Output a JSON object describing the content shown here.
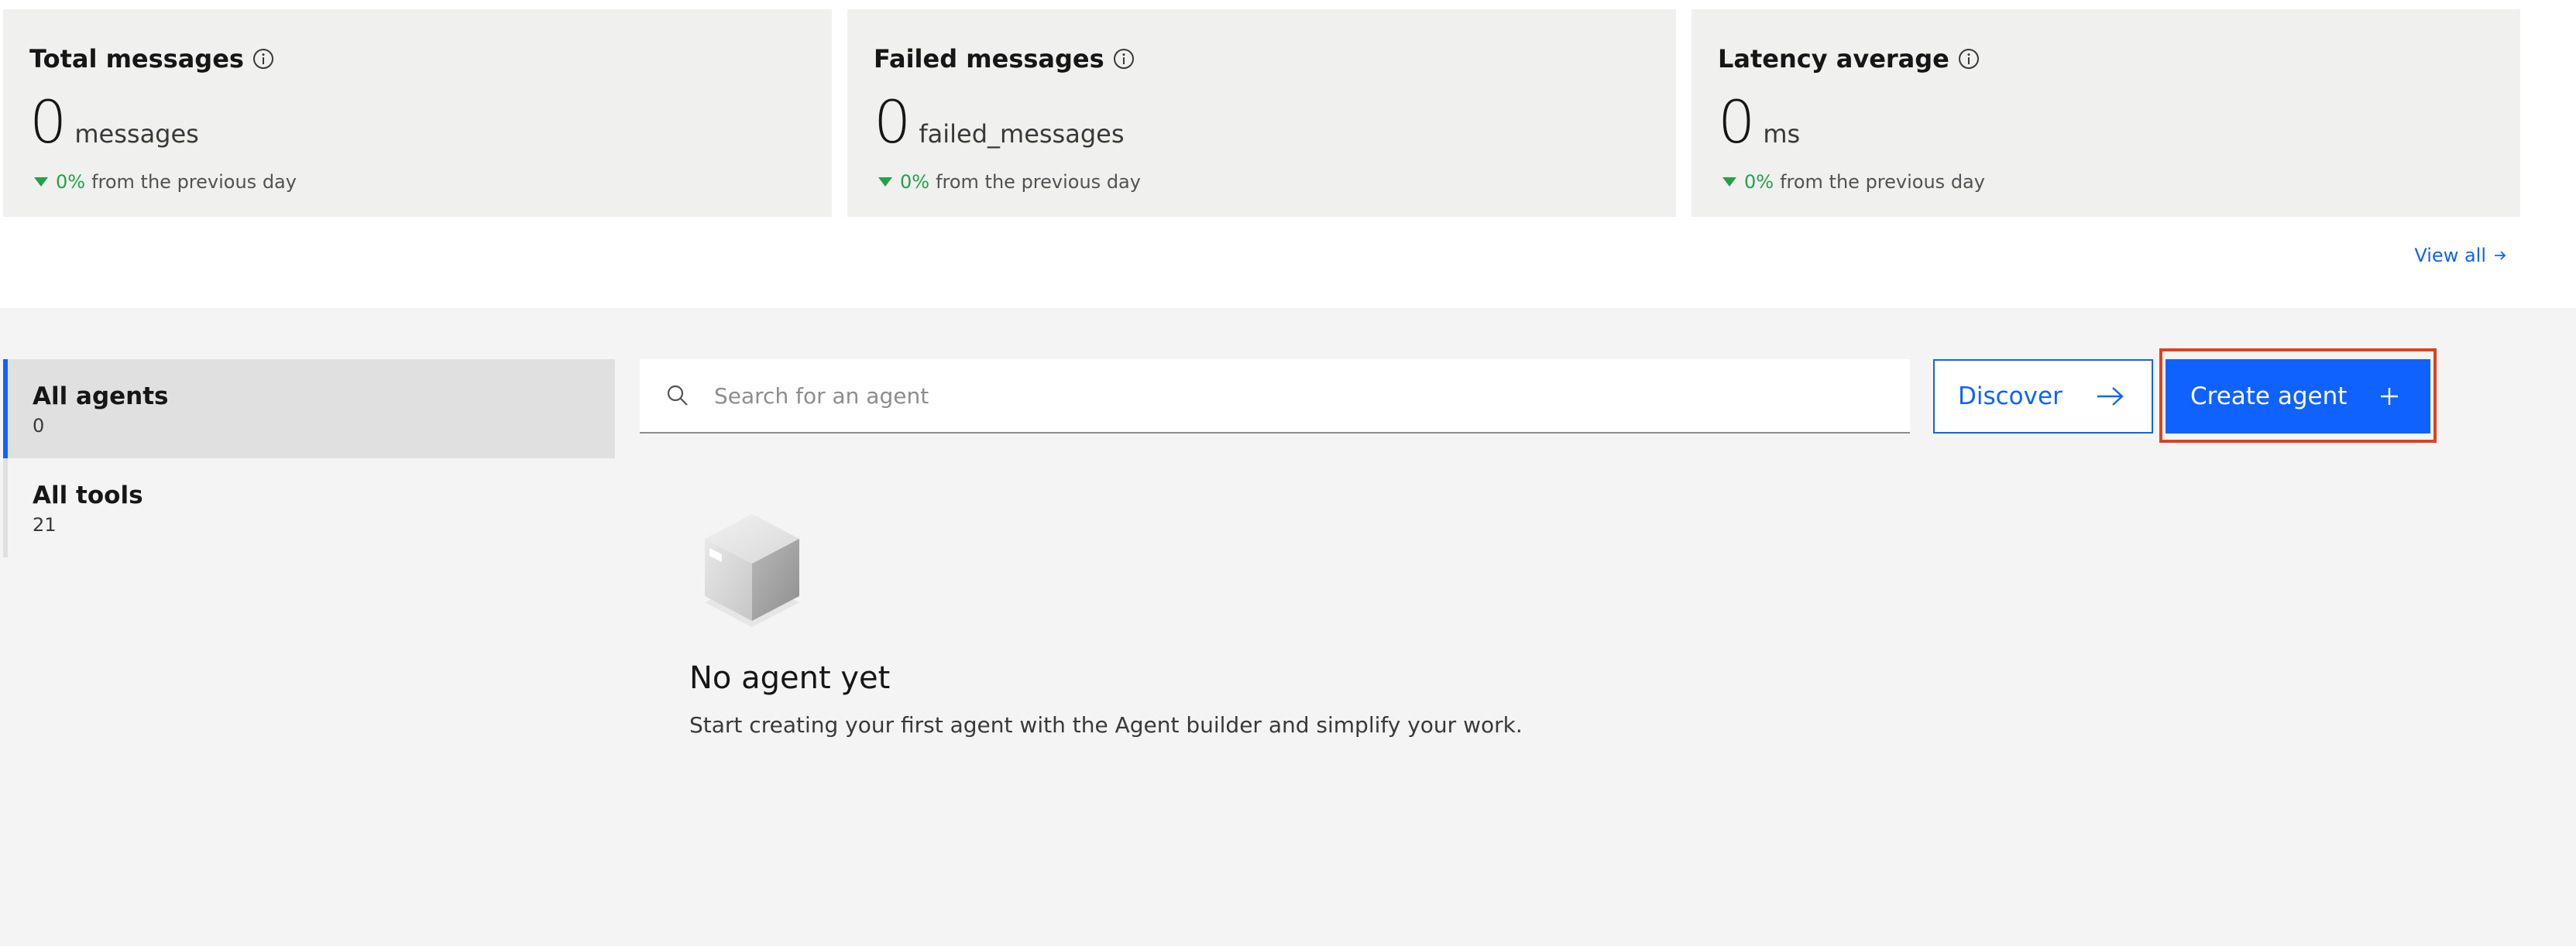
{
  "metrics": [
    {
      "title": "Total messages",
      "value": "0",
      "unit": "messages",
      "trend_pct": "0%",
      "trend_text": "from the previous day"
    },
    {
      "title": "Failed messages",
      "value": "0",
      "unit": "failed_messages",
      "trend_pct": "0%",
      "trend_text": "from the previous day"
    },
    {
      "title": "Latency average",
      "value": "0",
      "unit": "ms",
      "trend_pct": "0%",
      "trend_text": "from the previous day"
    }
  ],
  "view_all": {
    "label": "View all",
    "icon": "arrow-right-icon"
  },
  "side_nav": {
    "items": [
      {
        "label": "All agents",
        "count": "0",
        "active": true
      },
      {
        "label": "All tools",
        "count": "21",
        "active": false
      }
    ]
  },
  "search": {
    "placeholder": "Search for an agent",
    "value": "",
    "icon": "search-icon"
  },
  "actions": {
    "discover_label": "Discover",
    "discover_icon": "arrow-right-icon",
    "create_label": "Create agent",
    "create_icon": "plus-icon"
  },
  "empty_state": {
    "icon": "empty-box-icon",
    "title": "No agent yet",
    "description": "Start creating your first agent with the Agent builder and simplify your work."
  },
  "colors": {
    "accent": "#0f62fe",
    "trend_positive": "#24a148",
    "highlight": "#e0401f",
    "card_bg": "#f0f0ef",
    "page_bg": "#f4f4f4"
  }
}
